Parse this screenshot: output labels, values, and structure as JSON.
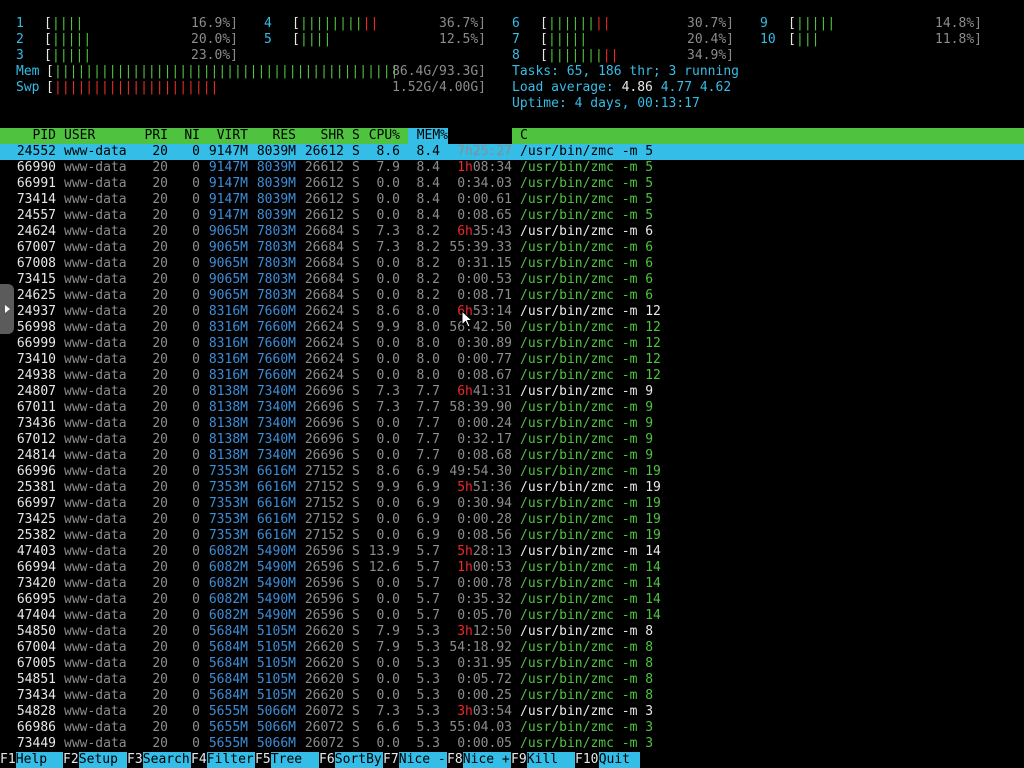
{
  "meters": {
    "cpu": [
      {
        "id": "1",
        "bar": "||||",
        "pct": "16.9%"
      },
      {
        "id": "2",
        "bar": "|||||",
        "pct": "20.0%"
      },
      {
        "id": "3",
        "bar": "|||||",
        "pct": "23.0%"
      },
      {
        "id": "4",
        "bar": "||||||||||",
        "pct": "36.7%"
      },
      {
        "id": "5",
        "bar": "||||",
        "pct": "12.5%"
      },
      {
        "id": "6",
        "bar": "||||||||",
        "pct": "30.7%"
      },
      {
        "id": "7",
        "bar": "|||||",
        "pct": "20.4%"
      },
      {
        "id": "8",
        "bar": "|||||||||",
        "pct": "34.9%"
      },
      {
        "id": "9",
        "bar": "|||||",
        "pct": "14.8%"
      },
      {
        "id": "10",
        "bar": "|||",
        "pct": "11.8%"
      }
    ],
    "mem": {
      "label": "Mem",
      "bar": "||||||||||||||||||||||||||||||||||||||||||||",
      "used": "86.4G",
      "total": "93.3G"
    },
    "swp": {
      "label": "Swp",
      "bar": "|||||||||||||||||||||",
      "used": "1.52G",
      "total": "4.00G"
    },
    "tasks": {
      "label": "Tasks:",
      "tasks": "65",
      "sep": ",",
      "thr": "186",
      "thr_label": "thr;",
      "running": "3",
      "running_label": "running"
    },
    "load": {
      "label": "Load average:",
      "l1": "4.86",
      "l5": "4.77",
      "l15": "4.62"
    },
    "uptime": {
      "label": "Uptime:",
      "value": "4 days, 00:13:17"
    }
  },
  "columns": {
    "pid": "PID",
    "user": "USER",
    "pri": "PRI",
    "ni": "NI",
    "virt": "VIRT",
    "res": "RES",
    "shr": "SHR",
    "s": "S",
    "cpu": "CPU%",
    "mem": "MEM%",
    "time": "",
    "command": "C"
  },
  "processes": [
    {
      "pid": "24552",
      "user": "www-data",
      "pri": "20",
      "ni": "0",
      "virt": "9147M",
      "res": "8039M",
      "shr": "26612",
      "s": "S",
      "cpu": "8.6",
      "mem": "8.4",
      "time_h": "",
      "time": "7h25:27",
      "cmd": "/usr/bin/zmc -m 5",
      "thread": false,
      "selected": true
    },
    {
      "pid": "66990",
      "user": "www-data",
      "pri": "20",
      "ni": "0",
      "virt": "9147M",
      "res": "8039M",
      "shr": "26612",
      "s": "S",
      "cpu": "7.9",
      "mem": "8.4",
      "time_h": "1h",
      "time": "08:34",
      "cmd": "/usr/bin/zmc -m 5",
      "thread": true
    },
    {
      "pid": "66991",
      "user": "www-data",
      "pri": "20",
      "ni": "0",
      "virt": "9147M",
      "res": "8039M",
      "shr": "26612",
      "s": "S",
      "cpu": "0.0",
      "mem": "8.4",
      "time_h": "",
      "time": "0:34.03",
      "cmd": "/usr/bin/zmc -m 5",
      "thread": true
    },
    {
      "pid": "73414",
      "user": "www-data",
      "pri": "20",
      "ni": "0",
      "virt": "9147M",
      "res": "8039M",
      "shr": "26612",
      "s": "S",
      "cpu": "0.0",
      "mem": "8.4",
      "time_h": "",
      "time": "0:00.61",
      "cmd": "/usr/bin/zmc -m 5",
      "thread": true
    },
    {
      "pid": "24557",
      "user": "www-data",
      "pri": "20",
      "ni": "0",
      "virt": "9147M",
      "res": "8039M",
      "shr": "26612",
      "s": "S",
      "cpu": "0.0",
      "mem": "8.4",
      "time_h": "",
      "time": "0:08.65",
      "cmd": "/usr/bin/zmc -m 5",
      "thread": true
    },
    {
      "pid": "24624",
      "user": "www-data",
      "pri": "20",
      "ni": "0",
      "virt": "9065M",
      "res": "7803M",
      "shr": "26684",
      "s": "S",
      "cpu": "7.3",
      "mem": "8.2",
      "time_h": "6h",
      "time": "35:43",
      "cmd": "/usr/bin/zmc -m 6",
      "thread": false
    },
    {
      "pid": "67007",
      "user": "www-data",
      "pri": "20",
      "ni": "0",
      "virt": "9065M",
      "res": "7803M",
      "shr": "26684",
      "s": "S",
      "cpu": "7.3",
      "mem": "8.2",
      "time_h": "",
      "time": "55:39.33",
      "cmd": "/usr/bin/zmc -m 6",
      "thread": true
    },
    {
      "pid": "67008",
      "user": "www-data",
      "pri": "20",
      "ni": "0",
      "virt": "9065M",
      "res": "7803M",
      "shr": "26684",
      "s": "S",
      "cpu": "0.0",
      "mem": "8.2",
      "time_h": "",
      "time": "0:31.15",
      "cmd": "/usr/bin/zmc -m 6",
      "thread": true
    },
    {
      "pid": "73415",
      "user": "www-data",
      "pri": "20",
      "ni": "0",
      "virt": "9065M",
      "res": "7803M",
      "shr": "26684",
      "s": "S",
      "cpu": "0.0",
      "mem": "8.2",
      "time_h": "",
      "time": "0:00.53",
      "cmd": "/usr/bin/zmc -m 6",
      "thread": true
    },
    {
      "pid": "24625",
      "user": "www-data",
      "pri": "20",
      "ni": "0",
      "virt": "9065M",
      "res": "7803M",
      "shr": "26684",
      "s": "S",
      "cpu": "0.0",
      "mem": "8.2",
      "time_h": "",
      "time": "0:08.71",
      "cmd": "/usr/bin/zmc -m 6",
      "thread": true
    },
    {
      "pid": "24937",
      "user": "www-data",
      "pri": "20",
      "ni": "0",
      "virt": "8316M",
      "res": "7660M",
      "shr": "26624",
      "s": "S",
      "cpu": "8.6",
      "mem": "8.0",
      "time_h": "6h",
      "time": "53:14",
      "cmd": "/usr/bin/zmc -m 12",
      "thread": false
    },
    {
      "pid": "56998",
      "user": "www-data",
      "pri": "20",
      "ni": "0",
      "virt": "8316M",
      "res": "7660M",
      "shr": "26624",
      "s": "S",
      "cpu": "9.9",
      "mem": "8.0",
      "time_h": "",
      "time": "56:42.50",
      "cmd": "/usr/bin/zmc -m 12",
      "thread": true
    },
    {
      "pid": "66999",
      "user": "www-data",
      "pri": "20",
      "ni": "0",
      "virt": "8316M",
      "res": "7660M",
      "shr": "26624",
      "s": "S",
      "cpu": "0.0",
      "mem": "8.0",
      "time_h": "",
      "time": "0:30.89",
      "cmd": "/usr/bin/zmc -m 12",
      "thread": true
    },
    {
      "pid": "73410",
      "user": "www-data",
      "pri": "20",
      "ni": "0",
      "virt": "8316M",
      "res": "7660M",
      "shr": "26624",
      "s": "S",
      "cpu": "0.0",
      "mem": "8.0",
      "time_h": "",
      "time": "0:00.77",
      "cmd": "/usr/bin/zmc -m 12",
      "thread": true
    },
    {
      "pid": "24938",
      "user": "www-data",
      "pri": "20",
      "ni": "0",
      "virt": "8316M",
      "res": "7660M",
      "shr": "26624",
      "s": "S",
      "cpu": "0.0",
      "mem": "8.0",
      "time_h": "",
      "time": "0:08.67",
      "cmd": "/usr/bin/zmc -m 12",
      "thread": true
    },
    {
      "pid": "24807",
      "user": "www-data",
      "pri": "20",
      "ni": "0",
      "virt": "8138M",
      "res": "7340M",
      "shr": "26696",
      "s": "S",
      "cpu": "7.3",
      "mem": "7.7",
      "time_h": "6h",
      "time": "41:31",
      "cmd": "/usr/bin/zmc -m 9",
      "thread": false
    },
    {
      "pid": "67011",
      "user": "www-data",
      "pri": "20",
      "ni": "0",
      "virt": "8138M",
      "res": "7340M",
      "shr": "26696",
      "s": "S",
      "cpu": "7.3",
      "mem": "7.7",
      "time_h": "",
      "time": "58:39.90",
      "cmd": "/usr/bin/zmc -m 9",
      "thread": true
    },
    {
      "pid": "73436",
      "user": "www-data",
      "pri": "20",
      "ni": "0",
      "virt": "8138M",
      "res": "7340M",
      "shr": "26696",
      "s": "S",
      "cpu": "0.0",
      "mem": "7.7",
      "time_h": "",
      "time": "0:00.24",
      "cmd": "/usr/bin/zmc -m 9",
      "thread": true
    },
    {
      "pid": "67012",
      "user": "www-data",
      "pri": "20",
      "ni": "0",
      "virt": "8138M",
      "res": "7340M",
      "shr": "26696",
      "s": "S",
      "cpu": "0.0",
      "mem": "7.7",
      "time_h": "",
      "time": "0:32.17",
      "cmd": "/usr/bin/zmc -m 9",
      "thread": true
    },
    {
      "pid": "24814",
      "user": "www-data",
      "pri": "20",
      "ni": "0",
      "virt": "8138M",
      "res": "7340M",
      "shr": "26696",
      "s": "S",
      "cpu": "0.0",
      "mem": "7.7",
      "time_h": "",
      "time": "0:08.68",
      "cmd": "/usr/bin/zmc -m 9",
      "thread": true
    },
    {
      "pid": "66996",
      "user": "www-data",
      "pri": "20",
      "ni": "0",
      "virt": "7353M",
      "res": "6616M",
      "shr": "27152",
      "s": "S",
      "cpu": "8.6",
      "mem": "6.9",
      "time_h": "",
      "time": "49:54.30",
      "cmd": "/usr/bin/zmc -m 19",
      "thread": true
    },
    {
      "pid": "25381",
      "user": "www-data",
      "pri": "20",
      "ni": "0",
      "virt": "7353M",
      "res": "6616M",
      "shr": "27152",
      "s": "S",
      "cpu": "9.9",
      "mem": "6.9",
      "time_h": "5h",
      "time": "51:36",
      "cmd": "/usr/bin/zmc -m 19",
      "thread": false
    },
    {
      "pid": "66997",
      "user": "www-data",
      "pri": "20",
      "ni": "0",
      "virt": "7353M",
      "res": "6616M",
      "shr": "27152",
      "s": "S",
      "cpu": "0.0",
      "mem": "6.9",
      "time_h": "",
      "time": "0:30.94",
      "cmd": "/usr/bin/zmc -m 19",
      "thread": true
    },
    {
      "pid": "73425",
      "user": "www-data",
      "pri": "20",
      "ni": "0",
      "virt": "7353M",
      "res": "6616M",
      "shr": "27152",
      "s": "S",
      "cpu": "0.0",
      "mem": "6.9",
      "time_h": "",
      "time": "0:00.28",
      "cmd": "/usr/bin/zmc -m 19",
      "thread": true
    },
    {
      "pid": "25382",
      "user": "www-data",
      "pri": "20",
      "ni": "0",
      "virt": "7353M",
      "res": "6616M",
      "shr": "27152",
      "s": "S",
      "cpu": "0.0",
      "mem": "6.9",
      "time_h": "",
      "time": "0:08.56",
      "cmd": "/usr/bin/zmc -m 19",
      "thread": true
    },
    {
      "pid": "47403",
      "user": "www-data",
      "pri": "20",
      "ni": "0",
      "virt": "6082M",
      "res": "5490M",
      "shr": "26596",
      "s": "S",
      "cpu": "13.9",
      "mem": "5.7",
      "time_h": "5h",
      "time": "28:13",
      "cmd": "/usr/bin/zmc -m 14",
      "thread": false
    },
    {
      "pid": "66994",
      "user": "www-data",
      "pri": "20",
      "ni": "0",
      "virt": "6082M",
      "res": "5490M",
      "shr": "26596",
      "s": "S",
      "cpu": "12.6",
      "mem": "5.7",
      "time_h": "1h",
      "time": "00:53",
      "cmd": "/usr/bin/zmc -m 14",
      "thread": true
    },
    {
      "pid": "73420",
      "user": "www-data",
      "pri": "20",
      "ni": "0",
      "virt": "6082M",
      "res": "5490M",
      "shr": "26596",
      "s": "S",
      "cpu": "0.0",
      "mem": "5.7",
      "time_h": "",
      "time": "0:00.78",
      "cmd": "/usr/bin/zmc -m 14",
      "thread": true
    },
    {
      "pid": "66995",
      "user": "www-data",
      "pri": "20",
      "ni": "0",
      "virt": "6082M",
      "res": "5490M",
      "shr": "26596",
      "s": "S",
      "cpu": "0.0",
      "mem": "5.7",
      "time_h": "",
      "time": "0:35.32",
      "cmd": "/usr/bin/zmc -m 14",
      "thread": true
    },
    {
      "pid": "47404",
      "user": "www-data",
      "pri": "20",
      "ni": "0",
      "virt": "6082M",
      "res": "5490M",
      "shr": "26596",
      "s": "S",
      "cpu": "0.0",
      "mem": "5.7",
      "time_h": "",
      "time": "0:05.70",
      "cmd": "/usr/bin/zmc -m 14",
      "thread": true
    },
    {
      "pid": "54850",
      "user": "www-data",
      "pri": "20",
      "ni": "0",
      "virt": "5684M",
      "res": "5105M",
      "shr": "26620",
      "s": "S",
      "cpu": "7.9",
      "mem": "5.3",
      "time_h": "3h",
      "time": "12:50",
      "cmd": "/usr/bin/zmc -m 8",
      "thread": false
    },
    {
      "pid": "67004",
      "user": "www-data",
      "pri": "20",
      "ni": "0",
      "virt": "5684M",
      "res": "5105M",
      "shr": "26620",
      "s": "S",
      "cpu": "7.9",
      "mem": "5.3",
      "time_h": "",
      "time": "54:18.92",
      "cmd": "/usr/bin/zmc -m 8",
      "thread": true
    },
    {
      "pid": "67005",
      "user": "www-data",
      "pri": "20",
      "ni": "0",
      "virt": "5684M",
      "res": "5105M",
      "shr": "26620",
      "s": "S",
      "cpu": "0.0",
      "mem": "5.3",
      "time_h": "",
      "time": "0:31.95",
      "cmd": "/usr/bin/zmc -m 8",
      "thread": true
    },
    {
      "pid": "54851",
      "user": "www-data",
      "pri": "20",
      "ni": "0",
      "virt": "5684M",
      "res": "5105M",
      "shr": "26620",
      "s": "S",
      "cpu": "0.0",
      "mem": "5.3",
      "time_h": "",
      "time": "0:05.72",
      "cmd": "/usr/bin/zmc -m 8",
      "thread": true
    },
    {
      "pid": "73434",
      "user": "www-data",
      "pri": "20",
      "ni": "0",
      "virt": "5684M",
      "res": "5105M",
      "shr": "26620",
      "s": "S",
      "cpu": "0.0",
      "mem": "5.3",
      "time_h": "",
      "time": "0:00.25",
      "cmd": "/usr/bin/zmc -m 8",
      "thread": true
    },
    {
      "pid": "54828",
      "user": "www-data",
      "pri": "20",
      "ni": "0",
      "virt": "5655M",
      "res": "5066M",
      "shr": "26072",
      "s": "S",
      "cpu": "7.3",
      "mem": "5.3",
      "time_h": "3h",
      "time": "03:54",
      "cmd": "/usr/bin/zmc -m 3",
      "thread": false
    },
    {
      "pid": "66986",
      "user": "www-data",
      "pri": "20",
      "ni": "0",
      "virt": "5655M",
      "res": "5066M",
      "shr": "26072",
      "s": "S",
      "cpu": "6.6",
      "mem": "5.3",
      "time_h": "",
      "time": "55:04.03",
      "cmd": "/usr/bin/zmc -m 3",
      "thread": true
    },
    {
      "pid": "73449",
      "user": "www-data",
      "pri": "20",
      "ni": "0",
      "virt": "5655M",
      "res": "5066M",
      "shr": "26072",
      "s": "S",
      "cpu": "0.0",
      "mem": "5.3",
      "time_h": "",
      "time": "0:00.05",
      "cmd": "/usr/bin/zmc -m 3",
      "thread": true
    }
  ],
  "footer": [
    {
      "key": "F1",
      "label": "Help"
    },
    {
      "key": "F2",
      "label": "Setup"
    },
    {
      "key": "F3",
      "label": "Search"
    },
    {
      "key": "F4",
      "label": "Filter"
    },
    {
      "key": "F5",
      "label": "Tree"
    },
    {
      "key": "F6",
      "label": "SortBy"
    },
    {
      "key": "F7",
      "label": "Nice -"
    },
    {
      "key": "F8",
      "label": "Nice +"
    },
    {
      "key": "F9",
      "label": "Kill"
    },
    {
      "key": "F10",
      "label": "Quit"
    }
  ]
}
